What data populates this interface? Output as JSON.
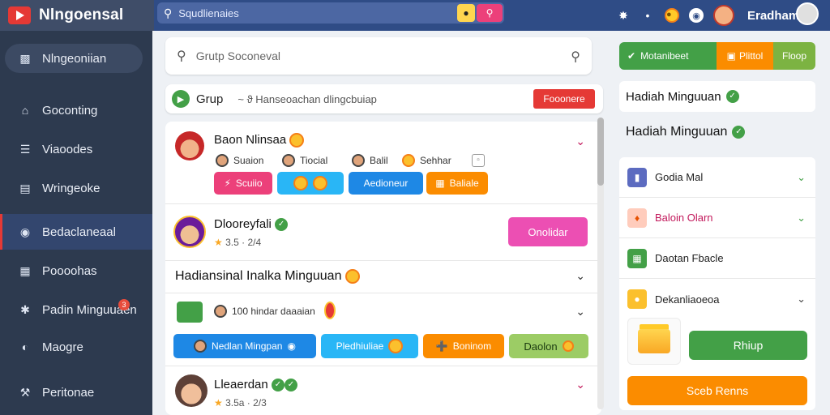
{
  "app": {
    "title": "Nlngoensal"
  },
  "top_search": {
    "placeholder": "Squdlienaies"
  },
  "user": {
    "name": "Eradham"
  },
  "sidebar": {
    "items": [
      {
        "label": "Nlngeoniian",
        "icon": "bar-chart-icon"
      },
      {
        "label": "Goconting",
        "icon": "home-icon"
      },
      {
        "label": "Viaoodes",
        "icon": "list-icon"
      },
      {
        "label": "Wringeoke",
        "icon": "document-icon"
      },
      {
        "label": "Bedaclaneaal",
        "icon": "target-icon"
      },
      {
        "label": "Poooohas",
        "icon": "grid-icon"
      },
      {
        "label": "Padin Minguuaen",
        "icon": "star-icon",
        "badge": "3"
      },
      {
        "label": "Maogre",
        "icon": "bell-icon"
      },
      {
        "label": "Peritonae",
        "icon": "hammer-icon"
      }
    ]
  },
  "main": {
    "search_placeholder": "Grutp Soconeval",
    "group": {
      "label": "Grup",
      "desc": "~ ϑ  Hanseoachan dlingcbuiap",
      "button": "Fooonere"
    },
    "post1": {
      "name": "Baon Nlinsaa",
      "users": [
        "Suaion",
        "Tiocial",
        "Balil",
        "Sehhar"
      ],
      "pills": [
        "Scuiio",
        "",
        "Aedioneur",
        "Baliale"
      ]
    },
    "post2": {
      "name": "Dlooreyfali",
      "stars": "3.5 · 2/4",
      "button": "Onolidar"
    },
    "section_title": "Hadiansinal Inalka Minguuan",
    "post3": {
      "meta": "100 hindar daaaian",
      "pills": [
        "Nedlan Mingpan",
        "Pledhiuliae",
        "Boninom",
        "Daolon"
      ]
    },
    "post4": {
      "name": "Lleaerdan",
      "stars": "3.5a · 2/3"
    }
  },
  "right": {
    "top_buttons": [
      "Motanibeet",
      "Plittol",
      "Floop"
    ],
    "head1": "Hadiah Minguuan",
    "head2": "Hadiah Minguuan",
    "items": [
      "Godia Mal",
      "Baloin Olarn",
      "Daotan Fbacle",
      "Dekanliaoeoa"
    ],
    "green_button": "Rhiup",
    "orange_button": "Sceb Renns"
  },
  "colors": {
    "topbar": "#2f4c86",
    "sidebar": "#2d3a4f",
    "accent_red": "#e53935",
    "green": "#43a047",
    "orange": "#fb8c00",
    "pink": "#ec407a"
  }
}
